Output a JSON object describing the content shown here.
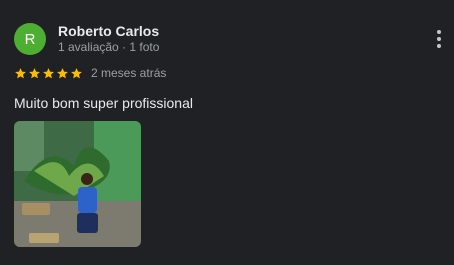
{
  "review": {
    "author_initial": "R",
    "author_name": "Roberto Carlos",
    "author_meta": "1 avaliação · 1 foto",
    "rating": 5,
    "date": "2 meses atrás",
    "text": "Muito bom super profissional"
  },
  "colors": {
    "background": "#202124",
    "avatar": "#4caf32",
    "star": "#fbbc04"
  },
  "icons": {
    "more": "more-vert-icon",
    "star": "star-icon"
  }
}
